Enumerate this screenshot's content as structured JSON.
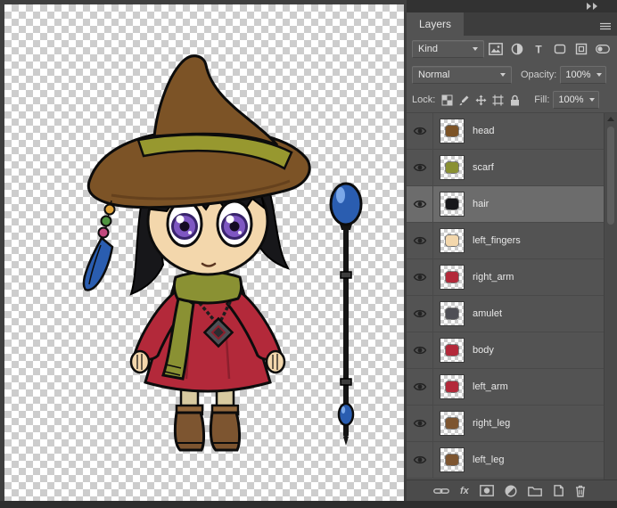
{
  "canvas": {
    "description": "chibi witch character with staff on transparent checkerboard",
    "art_colors": {
      "hat": "#7c5326",
      "hat_band": "#97982f",
      "hair": "#17171a",
      "skin": "#f3d7ac",
      "eyes": "#7e57c2",
      "dress": "#b3293a",
      "scarf": "#8a9133",
      "boots": "#7d5530",
      "socks": "#d8caa0",
      "staff_orb": "#2a5db0"
    }
  },
  "panel": {
    "tab_label": "Layers",
    "dock_icons": [
      "collapse-panels-icon",
      "panel-menu-icon"
    ],
    "filter": {
      "kind_label": "Kind",
      "icon_names": [
        "pixel-layer-filter-icon",
        "adjustment-layer-filter-icon",
        "type-layer-filter-icon",
        "shape-layer-filter-icon",
        "smart-object-filter-icon",
        "filter-toggle-icon"
      ]
    },
    "blend": {
      "mode_value": "Normal",
      "opacity_label": "Opacity:",
      "opacity_value": "100%"
    },
    "lock": {
      "label": "Lock:",
      "icon_names": [
        "lock-transparent-pixels-icon",
        "lock-image-pixels-icon",
        "lock-position-icon",
        "lock-artboard-icon",
        "lock-all-icon"
      ],
      "fill_label": "Fill:",
      "fill_value": "100%"
    },
    "layers": [
      {
        "name": "head",
        "thumb_color": "#7c5326",
        "selected": false
      },
      {
        "name": "scarf",
        "thumb_color": "#8a9133",
        "selected": false
      },
      {
        "name": "hair",
        "thumb_color": "#17171a",
        "selected": true
      },
      {
        "name": "left_fingers",
        "thumb_color": "#f3d7ac",
        "selected": false
      },
      {
        "name": "right_arm",
        "thumb_color": "#b3293a",
        "selected": false
      },
      {
        "name": "amulet",
        "thumb_color": "#4f4f55",
        "selected": false
      },
      {
        "name": "body",
        "thumb_color": "#b3293a",
        "selected": false
      },
      {
        "name": "left_arm",
        "thumb_color": "#b3293a",
        "selected": false
      },
      {
        "name": "right_leg",
        "thumb_color": "#7d5530",
        "selected": false
      },
      {
        "name": "left_leg",
        "thumb_color": "#7d5530",
        "selected": false
      }
    ],
    "bottom_bar": {
      "fx_label": "fx",
      "icon_names": [
        "link-layers-icon",
        "layer-style-icon",
        "layer-mask-icon",
        "adjustment-layer-icon",
        "new-group-icon",
        "new-layer-icon",
        "delete-layer-icon"
      ]
    }
  },
  "colors": {
    "panel_bg": "#535353",
    "selected_row": "#6c6c6c",
    "header_bg": "#3d3d3d",
    "canvas_checker": "#cdcdcd",
    "icon_gray": "#c9c9c9"
  }
}
